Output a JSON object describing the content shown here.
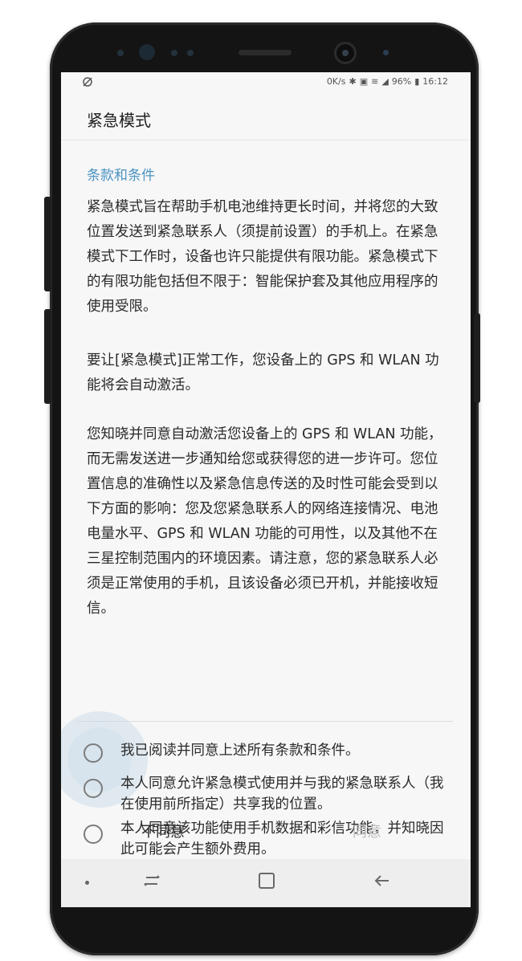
{
  "status_bar": {
    "left_icon": "sync-off-icon",
    "network_speed": "0K/s",
    "battery": "96%",
    "time": "16:12"
  },
  "app": {
    "title": "紧急模式"
  },
  "terms": {
    "section_title": "条款和条件",
    "paragraph_1": "紧急模式旨在帮助手机电池维持更长时间，并将您的大致位置发送到紧急联系人（须提前设置）的手机上。在紧急模式下工作时，设备也许只能提供有限功能。紧急模式下的有限功能包括但不限于：智能保护套及其他应用程序的使用受限。",
    "paragraph_2": "要让[紧急模式]正常工作，您设备上的 GPS 和 WLAN 功能将会自动激活。",
    "paragraph_3": "您知晓并同意自动激活您设备上的 GPS 和 WLAN 功能，而无需发送进一步通知给您或获得您的进一步许可。您位置信息的准确性以及紧急信息传送的及时性可能会受到以下方面的影响：您及您紧急联系人的网络连接情况、电池电量水平、GPS 和 WLAN 功能的可用性，以及其他不在三星控制范围内的环境因素。请注意，您的紧急联系人必须是正常使用的手机，且该设备必须已开机，并能接收短信。"
  },
  "options": [
    {
      "label": "我已阅读并同意上述所有条款和条件。",
      "checked": false
    },
    {
      "label": "本人同意允许紧急模式使用并与我的紧急联系人（我在使用前所指定）共享我的位置。",
      "checked": false
    },
    {
      "label": "本人同意该功能使用手机数据和彩信功能，并知晓因此可能会产生额外费用。",
      "checked": false
    }
  ],
  "buttons": {
    "disagree": "不同意",
    "agree": "同意"
  },
  "colors": {
    "accent": "#4b93c3",
    "disabled_text": "#bdbdbd",
    "screen_bg": "#f7f7f7",
    "phone_body": "#141414"
  },
  "nav_bar": {
    "icons": [
      "dot-icon",
      "recent-apps-icon",
      "home-icon",
      "back-icon"
    ]
  }
}
